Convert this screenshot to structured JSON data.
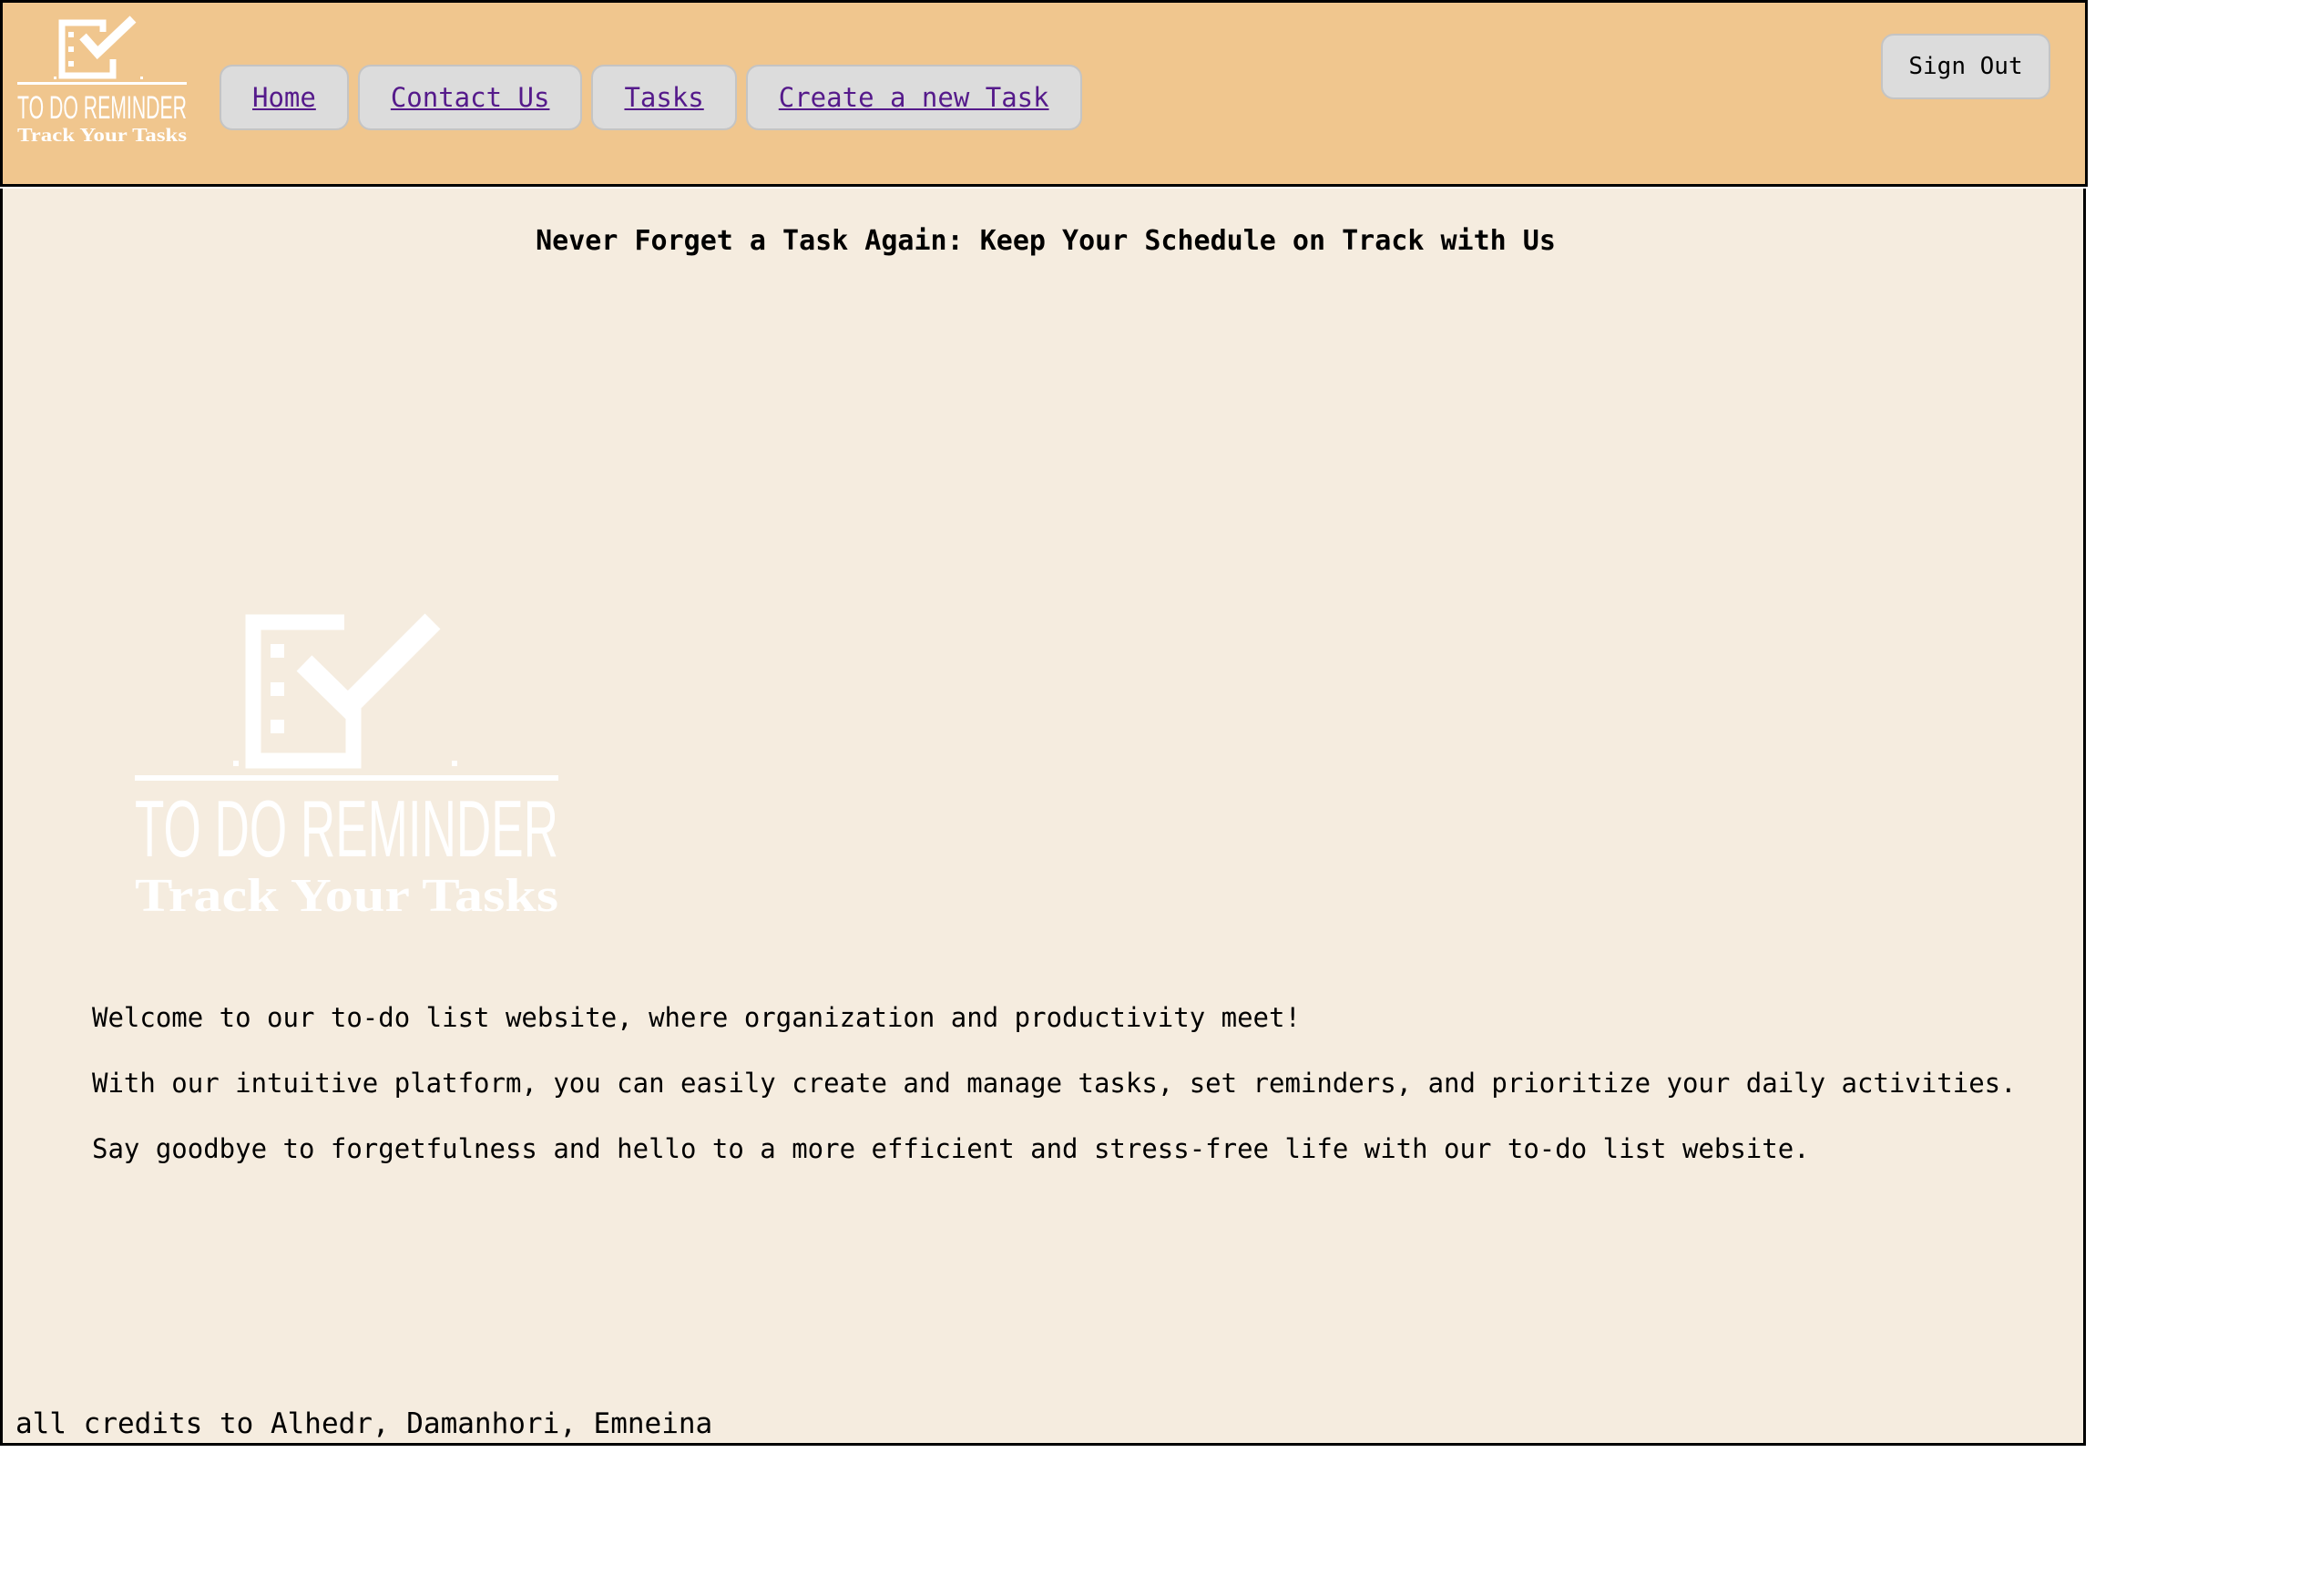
{
  "header": {
    "logo": {
      "title": "TO DO REMINDER",
      "tagline": "Track Your Tasks"
    },
    "nav": [
      {
        "label": "Home"
      },
      {
        "label": "Contact Us"
      },
      {
        "label": "Tasks"
      },
      {
        "label": "Create a new Task"
      }
    ],
    "sign_out_label": "Sign Out"
  },
  "main": {
    "headline": "Never Forget a Task Again: Keep Your Schedule on Track with Us",
    "hero_logo": {
      "title": "TO DO REMINDER",
      "tagline": "Track Your Tasks"
    },
    "paragraphs": [
      "Welcome to our to-do list website, where organization and productivity meet!",
      "With our intuitive platform, you can easily create and manage tasks, set reminders, and prioritize your daily activities.",
      "Say goodbye to forgetfulness and hello to a more efficient and stress-free life with our to-do list website."
    ],
    "footer": "all credits to Alhedr, Damanhori, Emneina"
  },
  "colors": {
    "header_bg": "#f0c68e",
    "main_bg": "#f5ecdf",
    "button_bg": "#dcdcdc",
    "link": "#551a8b",
    "logo": "#ffffff"
  },
  "icons": {
    "logo": "checklist-icon"
  }
}
